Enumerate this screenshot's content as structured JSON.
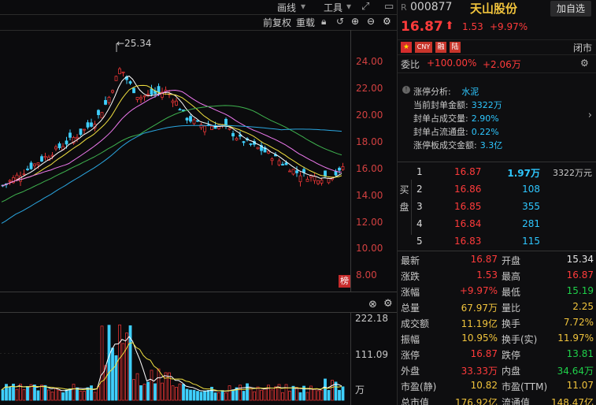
{
  "toolbar": {
    "draw_label": "画线",
    "tools_label": "工具",
    "adjust_label": "前复权",
    "overlay_label": "重载"
  },
  "chart": {
    "max_label": "←25.34",
    "price_ticks": [
      "24.00",
      "22.00",
      "20.00",
      "18.00",
      "16.00",
      "14.00",
      "12.00",
      "10.00",
      "8.00"
    ],
    "vol_ticks": [
      "222.18",
      "111.09",
      "万"
    ],
    "badge": "榜"
  },
  "chart_data": {
    "type": "candlestick",
    "price_ylim": [
      8,
      25.34
    ],
    "max_price": 25.34,
    "volume_ylim": [
      0,
      222.18
    ],
    "volume_unit": "万",
    "ma_colors": [
      "#ffffff",
      "#f0e040",
      "#f07af0",
      "#3fb34f",
      "#2aa6e0"
    ],
    "up_color": "#e03434",
    "down_color": "#3fd0ff"
  },
  "quote": {
    "r_flag": "R",
    "code": "000877",
    "name": "天山股份",
    "add_button": "加自选",
    "price": "16.87",
    "change": "1.53",
    "change_pct": "+9.97%",
    "flags": [
      "CNY",
      "融",
      "陆"
    ],
    "closed": "闭市",
    "weibi_label": "委比",
    "weibi_pct": "+100.00%",
    "weibi_amt": "+2.06万"
  },
  "limit_up": {
    "title": "涨停分析:",
    "sector": "水泥",
    "rows": [
      {
        "k": "当前封单金额:",
        "v": "3322万"
      },
      {
        "k": "封单占成交量:",
        "v": "2.90%"
      },
      {
        "k": "封单占流通盘:",
        "v": "0.22%"
      },
      {
        "k": "涨停板成交金额:",
        "v": "3.3亿"
      }
    ]
  },
  "orderbook": {
    "side_label": "买盘",
    "rows": [
      {
        "lvl": "1",
        "price": "16.87",
        "vol": "1.97万",
        "amt": "3322万元"
      },
      {
        "lvl": "2",
        "price": "16.86",
        "vol": "108",
        "amt": ""
      },
      {
        "lvl": "3",
        "price": "16.85",
        "vol": "355",
        "amt": ""
      },
      {
        "lvl": "4",
        "price": "16.84",
        "vol": "281",
        "amt": ""
      },
      {
        "lvl": "5",
        "price": "16.83",
        "vol": "115",
        "amt": ""
      }
    ]
  },
  "stats": [
    {
      "lk": "最新",
      "lv": "16.87",
      "lc": "red",
      "rk": "开盘",
      "rv": "15.34",
      "rc": "white"
    },
    {
      "lk": "涨跌",
      "lv": "1.53",
      "lc": "red",
      "rk": "最高",
      "rv": "16.87",
      "rc": "red"
    },
    {
      "lk": "涨幅",
      "lv": "+9.97%",
      "lc": "red",
      "rk": "最低",
      "rv": "15.19",
      "rc": "green"
    },
    {
      "lk": "总量",
      "lv": "67.97万",
      "lc": "gold",
      "rk": "量比",
      "rv": "2.25",
      "rc": "gold"
    },
    {
      "lk": "成交额",
      "lv": "11.19亿",
      "lc": "gold",
      "rk": "换手",
      "rv": "7.72%",
      "rc": "gold"
    },
    {
      "lk": "振幅",
      "lv": "10.95%",
      "lc": "gold",
      "rk": "换手(实)",
      "rv": "11.97%",
      "rc": "gold"
    },
    {
      "lk": "涨停",
      "lv": "16.87",
      "lc": "red",
      "rk": "跌停",
      "rv": "13.81",
      "rc": "green"
    },
    {
      "lk": "外盘",
      "lv": "33.33万",
      "lc": "red",
      "rk": "内盘",
      "rv": "34.64万",
      "rc": "green"
    },
    {
      "lk": "市盈(静)",
      "lv": "10.82",
      "lc": "gold",
      "rk": "市盈(TTM)",
      "rv": "11.07",
      "rc": "gold"
    },
    {
      "lk": "总市值",
      "lv": "176.92亿",
      "lc": "gold",
      "rk": "流通值",
      "rv": "148.47亿",
      "rc": "gold"
    }
  ]
}
